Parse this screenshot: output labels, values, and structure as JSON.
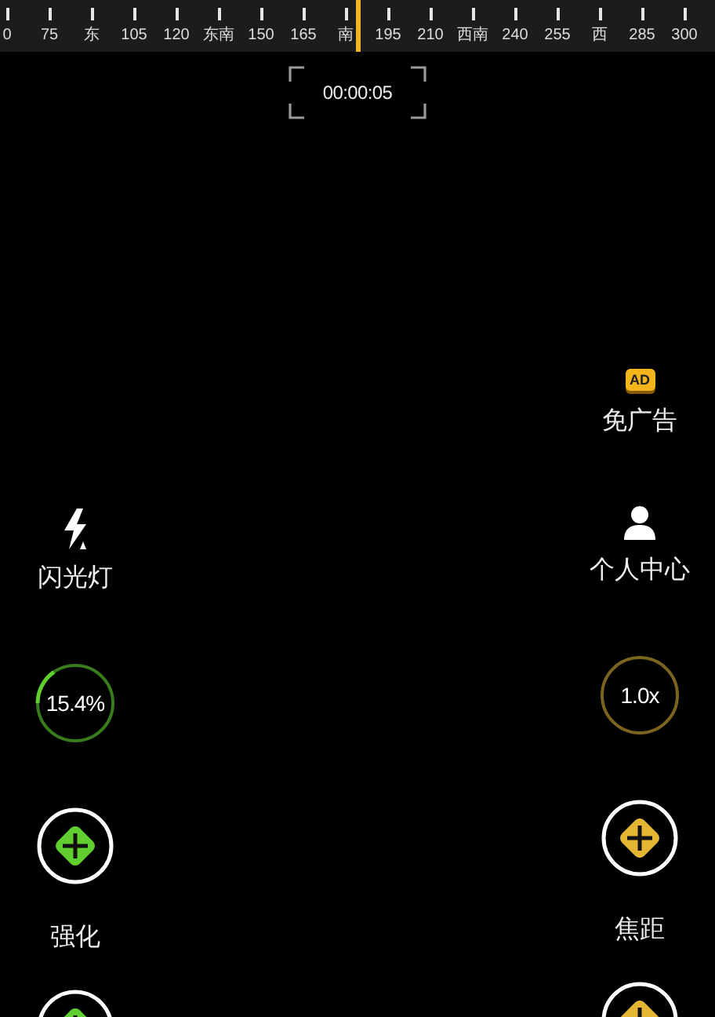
{
  "compass": {
    "ticks": [
      {
        "label": "0"
      },
      {
        "label": "75"
      },
      {
        "label": "东"
      },
      {
        "label": "105"
      },
      {
        "label": "120"
      },
      {
        "label": "东南"
      },
      {
        "label": "150"
      },
      {
        "label": "165"
      },
      {
        "label": "南"
      },
      {
        "label": "195"
      },
      {
        "label": "210"
      },
      {
        "label": "西南"
      },
      {
        "label": "240"
      },
      {
        "label": "255"
      },
      {
        "label": "西"
      },
      {
        "label": "285"
      },
      {
        "label": "300"
      }
    ]
  },
  "timer": "00:00:05",
  "left_controls": [
    {
      "kind": "flash",
      "label": "闪光灯"
    },
    {
      "kind": "dial",
      "reading": "15.4%",
      "level": 0.154,
      "color": "#5fce2e"
    },
    {
      "kind": "plus",
      "label": "强化",
      "color": "#5fce2e"
    },
    {
      "kind": "plus",
      "color": "#5fce2e"
    }
  ],
  "right_controls": [
    {
      "kind": "ad",
      "badge": "AD",
      "label": "免广告"
    },
    {
      "kind": "profile",
      "label": "个人中心"
    },
    {
      "kind": "dial",
      "reading": "1.0x",
      "color": "#7a6420"
    },
    {
      "kind": "plus",
      "label": "焦距",
      "color": "#e3b734"
    },
    {
      "kind": "plus",
      "color": "#e3b734"
    }
  ]
}
